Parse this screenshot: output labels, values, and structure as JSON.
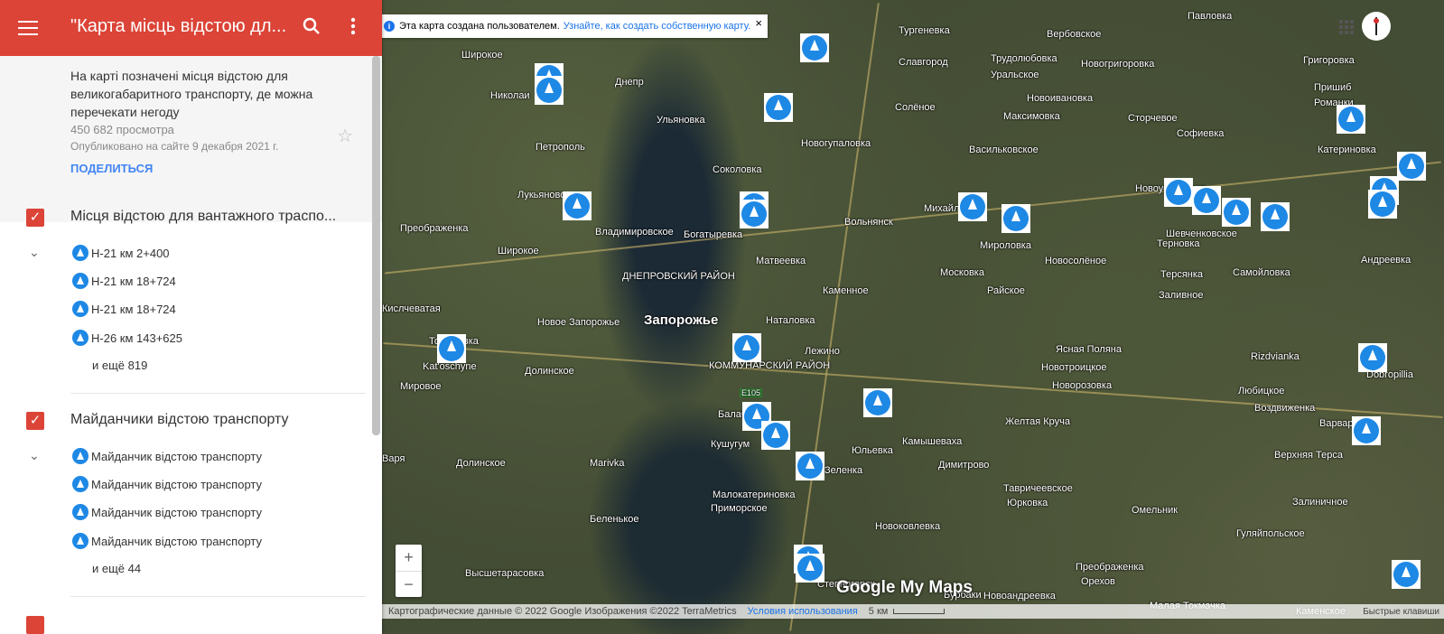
{
  "sidebar": {
    "title": "\"Карта місць відстою дл...",
    "description": "На карті позначені місця відстою для великогабаритного транспорту, де можна перечекати негоду",
    "views": "450 682 просмотра",
    "published": "Опубликовано на сайте 9 декабря 2021 г.",
    "share": "ПОДЕЛИТЬСЯ",
    "layers": [
      {
        "name": "Місця відстою для вантажного трaспо...",
        "items": [
          "Н-21 км 2+400",
          "Н-21 км 18+724",
          "Н-21 км 18+724",
          "Н-26 км 143+625"
        ],
        "more": "и ещё 819"
      },
      {
        "name": "Майданчики відстою транспорту",
        "items": [
          "Майданчик відстою транспорту",
          "Майданчик відстою транспорту",
          "Майданчик відстою транспорту",
          "Майданчик відстою транспорту"
        ],
        "more": "и ещё 44"
      }
    ]
  },
  "map": {
    "info_text": "Эта карта создана пользователем.",
    "info_link": "Узнайте, как создать собственную карту.",
    "attribution": "Картографические данные © 2022 Google Изображения ©2022 TerraMetrics",
    "terms": "Условия использования",
    "scale": "5 км",
    "shortcuts": "Быстрые клавиши",
    "logo": "Google My Maps",
    "zoom_in": "+",
    "zoom_out": "−",
    "city": "Запорожье",
    "district1": "ДНЕПРОВСКИЙ РАЙОН",
    "district2": "КОММУНАРСКИЙ РАЙОН",
    "road": "E105",
    "labels": [
      "Тургеневка",
      "Вербовское",
      "Павловка",
      "Широкое",
      "Славгород",
      "Трудолюбовка",
      "Новогригоровка",
      "Григоровка",
      "Днепр",
      "Николаи",
      "Ульяновка",
      "Уральское",
      "Новоивановка",
      "Пришиб",
      "Солёное",
      "Максимовка",
      "Сторчевое",
      "Романки",
      "Петрополь",
      "Новогупаловка",
      "Софиевка",
      "Катериновка",
      "Соколовка",
      "Васильковское",
      "Лукьяново",
      "Михайловка",
      "Новоуспеновка",
      "Владимировское",
      "Богатыревка",
      "Вольнянск",
      "Мироловка",
      "Шевченковское",
      "Преображенка",
      "Широкое",
      "Терновка",
      "Матвеевка",
      "Московка",
      "Новосолёное",
      "Андреевка",
      "Терсянка",
      "Самойловка",
      "Каменное",
      "Райское",
      "Заливное",
      "Кислчеватая",
      "Новое Запорожье",
      "Наталовка",
      "Запорожье",
      "Томаровка",
      "Лежино",
      "Ясная Поляна",
      "Новотроицкое",
      "Rizdvianka",
      "Kat'oschyne",
      "Долинское",
      "Мировое",
      "Новорозовка",
      "Любицкое",
      "Dobropillia",
      "Балабино",
      "Воздвиженка",
      "Желтая Круча",
      "Кушугум",
      "Юльевка",
      "Камышеваха",
      "Варваровка",
      "Варя",
      "Долинское",
      "Marivka",
      "Зеленка",
      "Димитрово",
      "Верхняя Терса",
      "Тавричеевское",
      "Малокатериновка",
      "Юрковка",
      "Залиничное",
      "Приморское",
      "Беленькое",
      "Омельник",
      "Новоковлевка",
      "Гуляйпольское",
      "Высшетарасовка",
      "Преображенка",
      "Степногорск",
      "Орехов",
      "Бурбаки",
      "Новоандреевка",
      "Малая Токмачка",
      "Каменское"
    ]
  }
}
